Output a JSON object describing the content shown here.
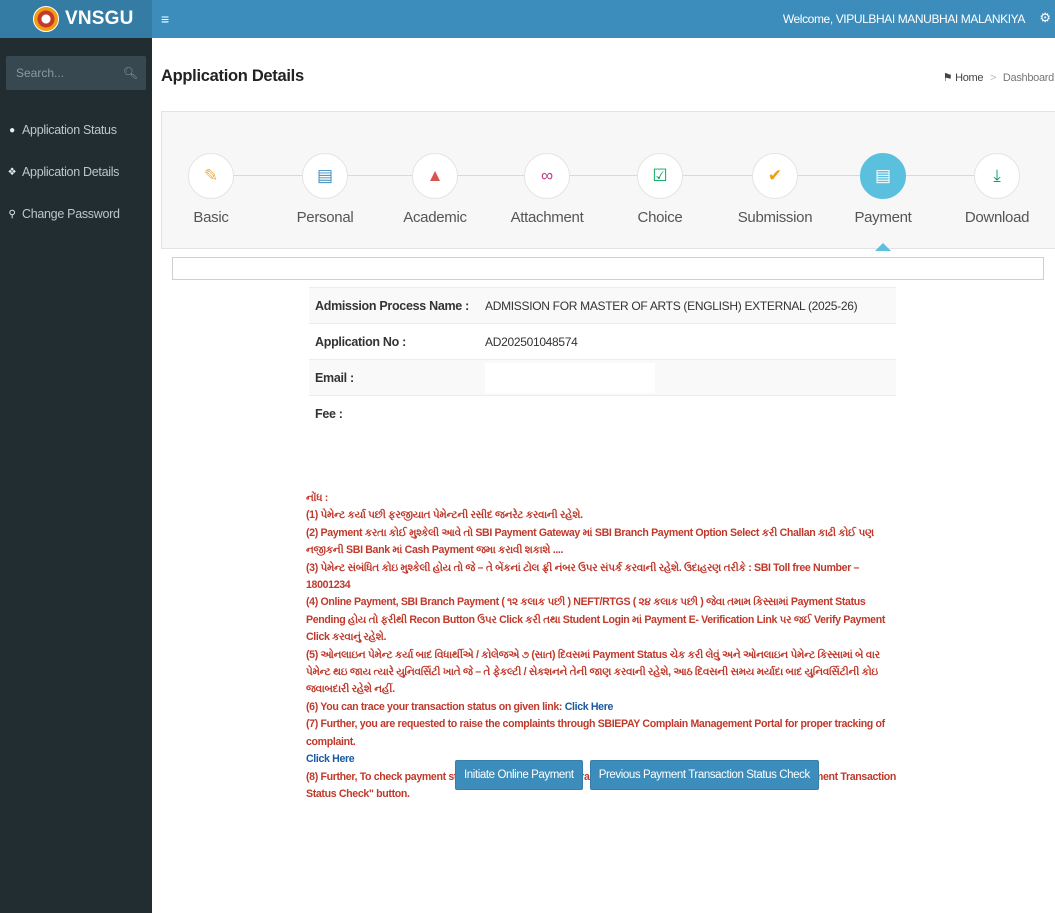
{
  "brand": {
    "name": "VNSGU"
  },
  "header": {
    "menu_icon": "hamburger-icon",
    "welcome": "Welcome, VIPULBHAI MANUBHAI MALANKIYA",
    "settings_icon": "gears-icon"
  },
  "sidebar": {
    "search_placeholder": "Search...",
    "items": [
      {
        "label": "Application Status",
        "icon": "dashboard-icon"
      },
      {
        "label": "Application Details",
        "icon": "info-icon"
      },
      {
        "label": "Change Password",
        "icon": "key-icon"
      }
    ]
  },
  "page": {
    "title": "Application Details",
    "breadcrumb": {
      "home": "Home",
      "current": "Dashboard"
    }
  },
  "wizard": {
    "steps": [
      {
        "label": "Basic",
        "icon": "pencil-icon",
        "color": "#f0ad4e"
      },
      {
        "label": "Personal",
        "icon": "id-card-icon",
        "color": "#3c8dbc"
      },
      {
        "label": "Academic",
        "icon": "graduation-cap-icon",
        "color": "#d9534f"
      },
      {
        "label": "Attachment",
        "icon": "paperclip-icon",
        "color": "#c0398a"
      },
      {
        "label": "Choice",
        "icon": "checkbox-icon",
        "color": "#00a65a"
      },
      {
        "label": "Submission",
        "icon": "checkmark-icon",
        "color": "#f39c12"
      },
      {
        "label": "Payment",
        "icon": "credit-card-icon",
        "color": "#ffffff",
        "active": true
      },
      {
        "label": "Download",
        "icon": "download-icon",
        "color": "#00a65a"
      }
    ]
  },
  "application": {
    "process_label": "Admission Process Name :",
    "process_value": "ADMISSION FOR MASTER OF ARTS (ENGLISH) EXTERNAL (2025-26)",
    "appno_label": "Application No :",
    "appno_value": "AD202501048574",
    "email_label": "Email :",
    "fee_label": "Fee :"
  },
  "notes": {
    "heading": "નોંધ :",
    "n1": "(1) પેમેન્ટ કર્યા પછી ફરજીયાત પેમેન્ટની રસીદ જનરેટ કરવાની રહેશે.",
    "n2": "(2) Payment કરતા કોઈ મુશ્કેલી આવે તો SBI Payment Gateway માં SBI Branch Payment Option Select કરી Challan કાઢી કોઈ પણ નજીકની SBI Bank માં Cash Payment જમા કરાવી શકાશે ....",
    "n3": "(3) પેમેન્ટ સંબંધિત કોઇ મુશ્કેલી હોય તો જે – તે બેંકનાં ટોલ ફ્રી નંબર ઉપર સંપર્ક કરવાની રહેશે. ઉદાહરણ તરીકે : SBI Toll free Number – 18001234",
    "n4": "(4) Online Payment, SBI Branch Payment ( ૧૨ કલાક પછી ) NEFT/RTGS ( ૨૪ કલાક પછી ) જેવા તમામ કિસ્સામાં Payment Status Pending હોય તો ફરીથી Recon Button ઉપર Click કરી તથા Student Login માં Payment E- Verification Link પર જઈ Verify Payment Click કરવાનું રહેશે.",
    "n5": "(5) ઓનલાઇન પેમેન્ટ કર્યા બાદ વિધાર્થીએ / કોલેજએ ૭ (સાત) દિવસમાં Payment Status ચેક કરી લેવું અને ઓનલાઇન પેમેન્ટ કિસ્સામાં બે વાર પેમેન્ટ થઇ જાય ત્યારે યુનિવર્સિટી ખાતે જે – તે ફેકલ્ટી / સેકશનને તેની જાણ કરવાની રહેશે, આઠ દિવસની સમય મર્યાદા બાદ યુનિવર્સિટીની કોઇ જવાબદારી રહેશે નહીં.",
    "n6": "(6) You can trace your transaction status on given link:",
    "n6_link": "Click Here",
    "n7": "(7) Further, you are requested to raise the complaints through SBIEPAY Complain Management Portal for proper tracking of complaint.",
    "n7_link": "Click Here",
    "n8": "(8) Further, To check payment status of prevous payment transaction number, please click on \"Previous Payment Transaction Status Check\" button."
  },
  "buttons": {
    "initiate": "Initiate Online Payment",
    "previous": "Previous Payment Transaction Status Check"
  },
  "colors": {
    "header": "#3c8dbc",
    "logo_bg": "#357ca5",
    "sidebar": "#222d32",
    "active_step": "#5bc0de",
    "notes": "#c0392b",
    "link": "#1a5aa0"
  }
}
